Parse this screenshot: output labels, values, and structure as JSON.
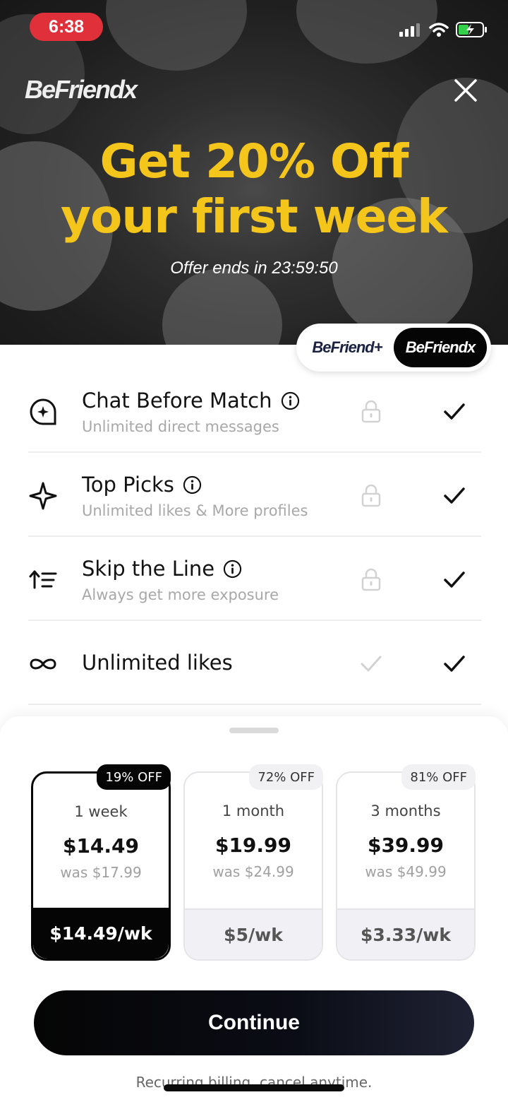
{
  "status_bar": {
    "time": "6:38"
  },
  "brand": {
    "logo_text": "BeFriendx",
    "accent_color": "#f4c51a"
  },
  "hero": {
    "headline_line1": "Get 20% Off",
    "headline_line2": "your first week",
    "offer_ends": "Offer ends in 23:59:50"
  },
  "tier_toggle": {
    "option_plus": "BeFriend+",
    "option_x": "BeFriendx",
    "selected": "BeFriendx"
  },
  "features": [
    {
      "title": "Chat Before Match",
      "subtitle": "Unlimited direct messages",
      "icon": "chat-sparkle-icon",
      "has_info": true,
      "plus": "locked",
      "x": "check"
    },
    {
      "title": "Top Picks",
      "subtitle": "Unlimited likes & More profiles",
      "icon": "sparkle-icon",
      "has_info": true,
      "plus": "locked",
      "x": "check"
    },
    {
      "title": "Skip the Line",
      "subtitle": "Always get more exposure",
      "icon": "priority-list-icon",
      "has_info": true,
      "plus": "locked",
      "x": "check"
    },
    {
      "title": "Unlimited likes",
      "subtitle": "",
      "icon": "infinity-icon",
      "has_info": false,
      "plus": "check",
      "x": "check"
    }
  ],
  "plans": [
    {
      "badge": "19% OFF",
      "name": "1 week",
      "price": "$14.49",
      "was": "was $17.99",
      "per_week": "$14.49/wk",
      "selected": true
    },
    {
      "badge": "72% OFF",
      "name": "1 month",
      "price": "$19.99",
      "was": "was $24.99",
      "per_week": "$5/wk",
      "selected": false
    },
    {
      "badge": "81% OFF",
      "name": "3 months",
      "price": "$39.99",
      "was": "was $49.99",
      "per_week": "$3.33/wk",
      "selected": false
    }
  ],
  "cta": {
    "continue_label": "Continue",
    "billing_note": "Recurring billing, cancel anytime."
  }
}
